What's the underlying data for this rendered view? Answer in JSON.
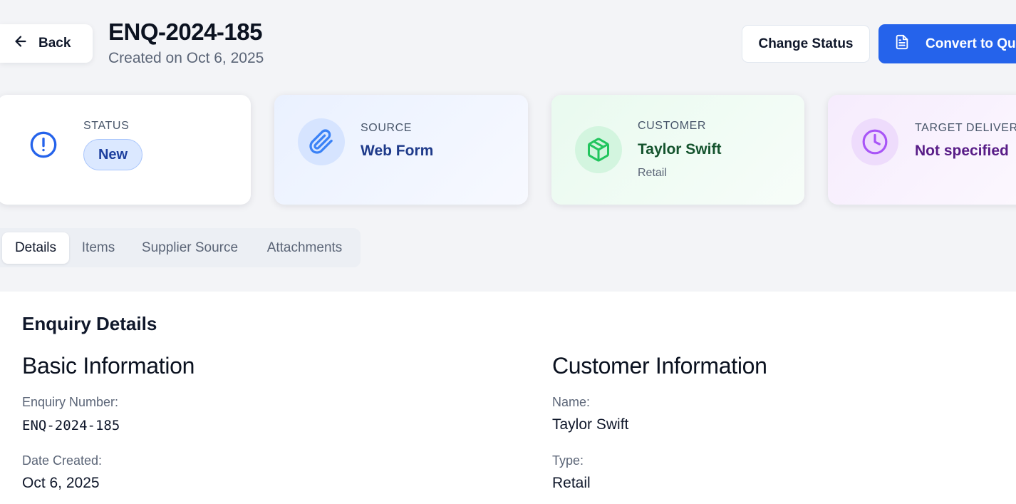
{
  "header": {
    "back_label": "Back",
    "title": "ENQ-2024-185",
    "subtitle": "Created on Oct 6, 2025",
    "change_status_label": "Change Status",
    "convert_label": "Convert to Quote"
  },
  "cards": {
    "status": {
      "label": "STATUS",
      "value": "New"
    },
    "source": {
      "label": "SOURCE",
      "value": "Web Form"
    },
    "customer": {
      "label": "CUSTOMER",
      "value": "Taylor Swift",
      "sub": "Retail"
    },
    "delivery": {
      "label": "TARGET DELIVERY",
      "value": "Not specified"
    }
  },
  "tabs": [
    {
      "label": "Details",
      "active": true
    },
    {
      "label": "Items",
      "active": false
    },
    {
      "label": "Supplier Source",
      "active": false
    },
    {
      "label": "Attachments",
      "active": false
    }
  ],
  "details": {
    "title": "Enquiry Details",
    "basic": {
      "heading": "Basic Information",
      "enquiry_number_label": "Enquiry Number:",
      "enquiry_number": "ENQ-2024-185",
      "date_created_label": "Date Created:",
      "date_created": "Oct 6, 2025"
    },
    "customer": {
      "heading": "Customer Information",
      "name_label": "Name:",
      "name": "Taylor Swift",
      "type_label": "Type:",
      "type": "Retail"
    }
  },
  "colors": {
    "primary": "#2563eb",
    "status_icon": "#2563eb",
    "source_icon": "#3b82f6",
    "customer_icon": "#22c55e",
    "delivery_icon": "#a855f7",
    "source_text": "#1e3a8a",
    "customer_text": "#14532d",
    "delivery_text": "#581c87"
  },
  "icons": {
    "back": "arrow-left-icon",
    "convert": "document-icon",
    "status": "alert-circle-icon",
    "source": "paperclip-icon",
    "customer": "package-icon",
    "delivery": "clock-icon"
  }
}
